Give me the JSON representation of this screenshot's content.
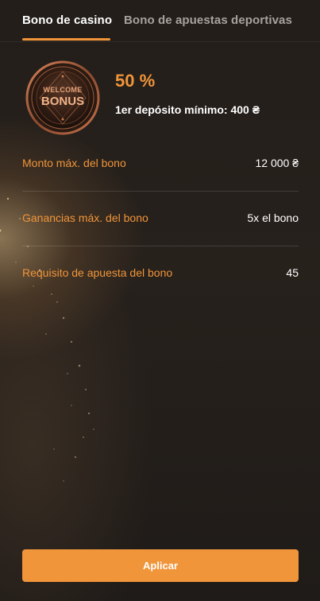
{
  "tabs": {
    "casino_label": "Bono de casino",
    "sports_label": "Bono de apuestas deportivas",
    "active": "casino"
  },
  "bonus": {
    "badge_text_top": "WELCOME",
    "badge_text_bottom": "BONUS",
    "percent": "50 %",
    "min_deposit": "1er depósito mínimo: 400 ₴"
  },
  "details": [
    {
      "label": "Monto máx. del bono",
      "value": "12 000 ₴"
    },
    {
      "label": "Ganancias máx. del bono",
      "value": "5x el bono"
    },
    {
      "label": "Requisito de apuesta del bono",
      "value": "45"
    }
  ],
  "actions": {
    "apply_label": "Aplicar"
  },
  "colors": {
    "accent": "#f0953a",
    "background": "#221d19",
    "text_primary": "#ffffff",
    "text_inactive": "#a8a29c"
  }
}
